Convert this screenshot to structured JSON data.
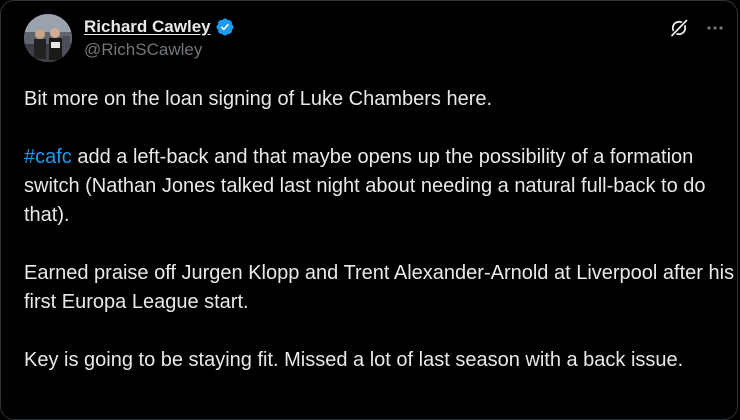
{
  "author": {
    "display_name": "Richard Cawley",
    "handle": "@RichSCawley",
    "verified": true,
    "avatar_icon": "profile-photo"
  },
  "actions": {
    "grok_icon": "grok-icon",
    "more_icon": "more-options-icon"
  },
  "tweet": {
    "paragraph_1": "Bit more on the loan signing of Luke Chambers here.",
    "paragraph_2_hashtag": "#cafc",
    "paragraph_2_rest": " add a left-back and that maybe opens up the possibility of a formation switch (Nathan Jones talked last night about needing a natural full-back to do that).",
    "paragraph_3": "Earned praise off Jurgen Klopp and Trent Alexander-Arnold at Liverpool after his first Europa League start.",
    "paragraph_4": "Key is going to be staying fit. Missed a lot of last season with a back issue."
  },
  "colors": {
    "background": "#000000",
    "text": "#e7e9ea",
    "secondary_text": "#71767b",
    "link": "#1d9bf0",
    "verified_badge": "#1d9bf0"
  }
}
